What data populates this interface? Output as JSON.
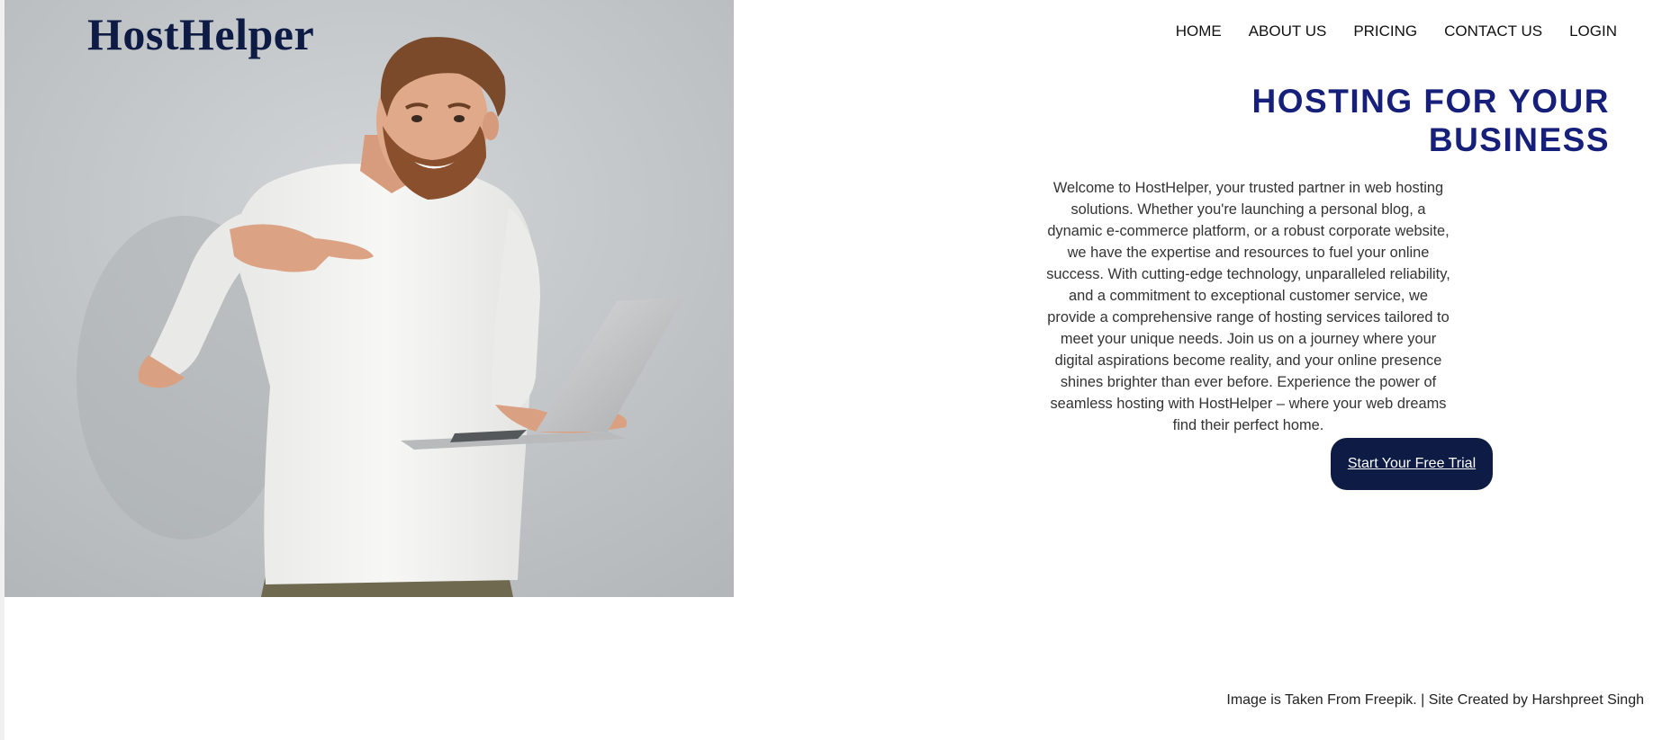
{
  "site": {
    "logo": "HostHelper"
  },
  "nav": {
    "items": [
      {
        "label": "HOME"
      },
      {
        "label": "ABOUT US"
      },
      {
        "label": "PRICING"
      },
      {
        "label": "CONTACT US"
      },
      {
        "label": "LOGIN"
      }
    ]
  },
  "hero": {
    "headline_line1": "HOSTING FOR YOUR",
    "headline_line2": "BUSINESS",
    "intro": "Welcome to HostHelper, your trusted partner in web hosting solutions. Whether you're launching a personal blog, a dynamic e-commerce platform, or a robust corporate website, we have the expertise and resources to fuel your online success. With cutting-edge technology, unparalleled reliability, and a commitment to exceptional customer service, we provide a comprehensive range of hosting services tailored to meet your unique needs. Join us on a journey where your digital aspirations become reality, and your online presence shines brighter than ever before. Experience the power of seamless hosting with HostHelper – where your web dreams find their perfect home.",
    "cta_label": "Start Your Free Trial",
    "photo_icon": "man-with-laptop-photo"
  },
  "footer": {
    "credit": "Image is Taken From Freepik. | Site Created by Harshpreet Singh"
  },
  "colors": {
    "brand_navy": "#0d1b45",
    "headline_blue": "#16207a",
    "photo_background": "#c3c7ca"
  }
}
